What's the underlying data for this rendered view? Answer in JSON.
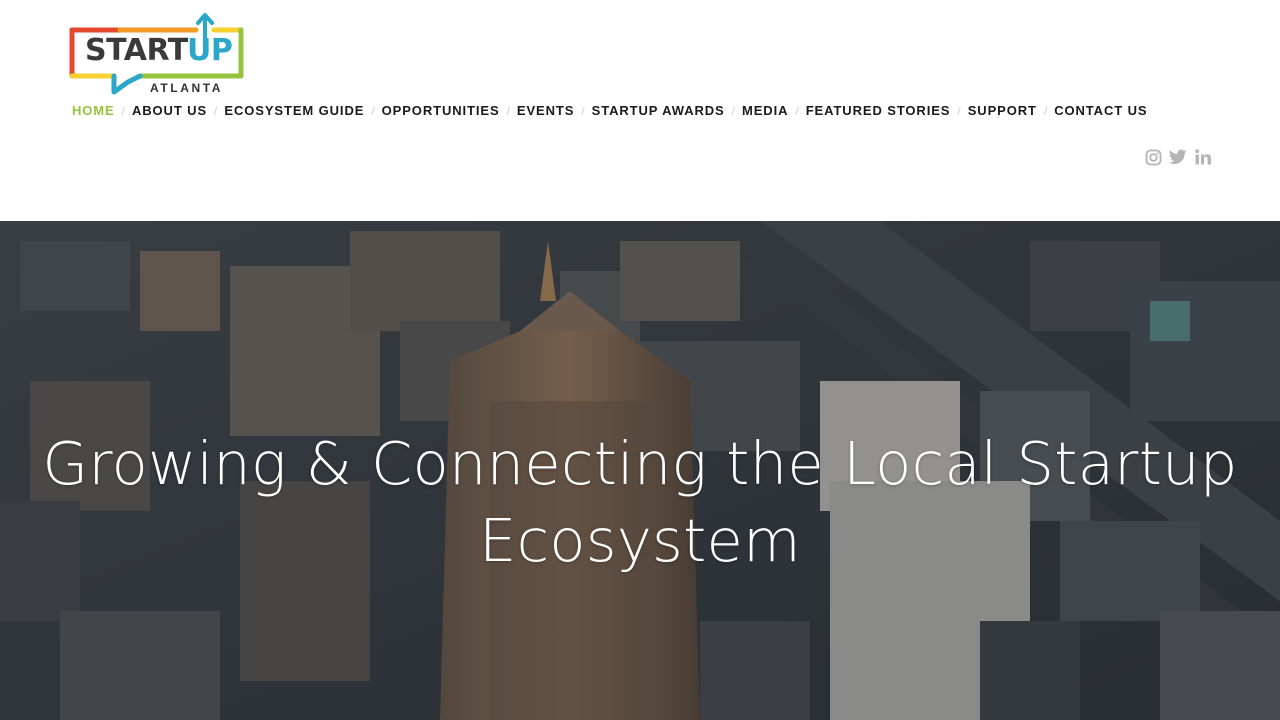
{
  "logo": {
    "word_start": "START",
    "word_up": "UP",
    "city": "ATLANTA",
    "colors": {
      "red": "#e4462e",
      "orange": "#f29a23",
      "yellow": "#f7d12f",
      "green": "#94c43c",
      "blue": "#2aa7c9",
      "dark": "#3a3a3a"
    }
  },
  "nav": {
    "separator": "/",
    "items": [
      {
        "label": "HOME",
        "active": true
      },
      {
        "label": "ABOUT US"
      },
      {
        "label": "ECOSYSTEM GUIDE"
      },
      {
        "label": "OPPORTUNITIES"
      },
      {
        "label": "EVENTS"
      },
      {
        "label": "STARTUP AWARDS"
      },
      {
        "label": "MEDIA"
      },
      {
        "label": "FEATURED STORIES"
      },
      {
        "label": "SUPPORT"
      },
      {
        "label": "CONTACT US"
      }
    ],
    "active_color": "#94c43c",
    "text_color": "#1a1a1a"
  },
  "social": {
    "icons": [
      "instagram-icon",
      "twitter-icon",
      "linkedin-icon"
    ],
    "color": "#b5b5b5"
  },
  "hero": {
    "title": "Growing & Connecting the Local Startup Ecosystem",
    "background": "aerial photo of downtown city skyline"
  }
}
